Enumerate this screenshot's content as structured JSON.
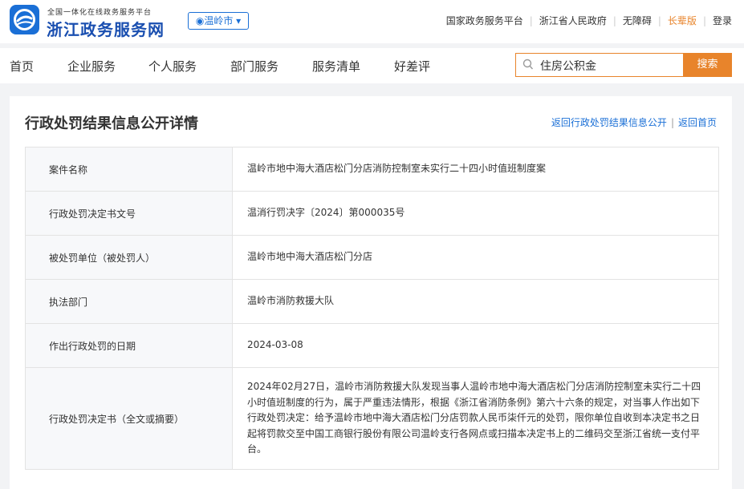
{
  "header": {
    "logo_subtitle": "全国一体化在线政务服务平台",
    "logo_title": "浙江政务服务网",
    "city": "温岭市",
    "links": [
      "国家政务服务平台",
      "浙江省人民政府",
      "无障碍",
      "长辈版",
      "登录"
    ]
  },
  "nav": {
    "items": [
      "首页",
      "企业服务",
      "个人服务",
      "部门服务",
      "服务清单",
      "好差评"
    ],
    "search_value": "住房公积金",
    "search_button": "搜索"
  },
  "page": {
    "title": "行政处罚结果信息公开详情",
    "back_list": "返回行政处罚结果信息公开",
    "back_home": "返回首页"
  },
  "details": [
    {
      "label": "案件名称",
      "value": "温岭市地中海大酒店松门分店消防控制室未实行二十四小时值班制度案"
    },
    {
      "label": "行政处罚决定书文号",
      "value": "温消行罚决字〔2024〕第000035号"
    },
    {
      "label": "被处罚单位（被处罚人）",
      "value": "温岭市地中海大酒店松门分店"
    },
    {
      "label": "执法部门",
      "value": "温岭市消防救援大队"
    },
    {
      "label": "作出行政处罚的日期",
      "value": "2024-03-08"
    },
    {
      "label": "行政处罚决定书（全文或摘要）",
      "value": "2024年02月27日，温岭市消防救援大队发现当事人温岭市地中海大酒店松门分店消防控制室未实行二十四小时值班制度的行为，属于严重违法情形，根据《浙江省消防条例》第六十六条的规定，对当事人作出如下行政处罚决定：给予温岭市地中海大酒店松门分店罚款人民币柒仟元的处罚，限你单位自收到本决定书之日起将罚款交至中国工商银行股份有限公司温岭支行各网点或扫描本决定书上的二维码交至浙江省统一支付平台。"
    }
  ],
  "colors": {
    "brand": "#1a6fd6",
    "accent": "#e8842b"
  }
}
